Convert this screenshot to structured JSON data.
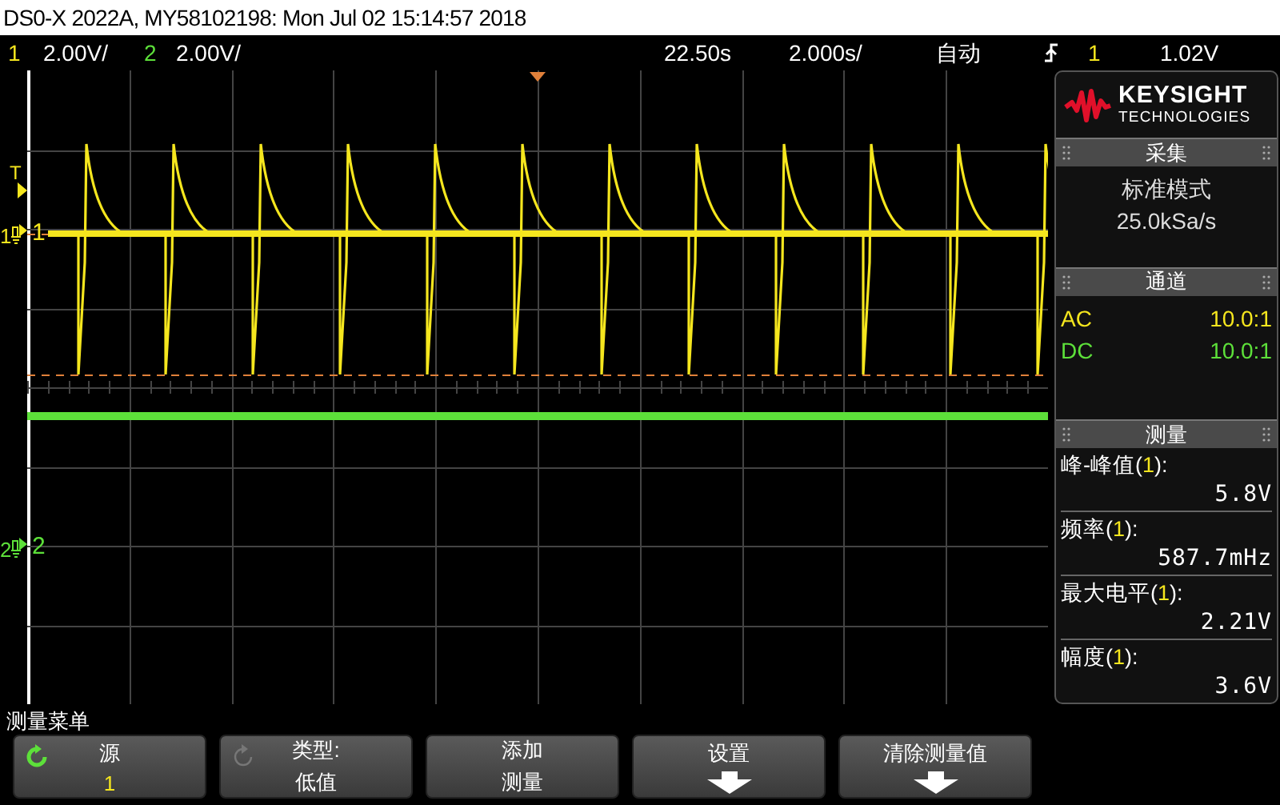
{
  "window": {
    "title": "DS0-X 2022A, MY58102198: Mon Jul 02 15:14:57 2018"
  },
  "status_bar": {
    "channels": [
      {
        "number": "1",
        "scale": "2.00V/",
        "color": "#f5e61e"
      },
      {
        "number": "2",
        "scale": "2.00V/",
        "color": "#5de03a"
      }
    ],
    "time_offset": "22.50s",
    "time_scale": "2.000s/",
    "trigger_mode": "自动",
    "trigger_source": "1",
    "trigger_level": "1.02V"
  },
  "screen": {
    "markers": [
      {
        "kind": "trigger",
        "label": "T",
        "color": "#f5e61e"
      },
      {
        "kind": "channel",
        "label": "1",
        "tag": "1",
        "color": "#f5e61e"
      },
      {
        "kind": "channel",
        "label": "2",
        "tag": "2",
        "color": "#5de03a"
      }
    ]
  },
  "panel": {
    "logo": {
      "name": "KEYSIGHT",
      "subtitle": "TECHNOLOGIES"
    },
    "acquisition": {
      "title": "采集",
      "mode": "标准模式",
      "rate": "25.0kSa/s"
    },
    "channels": {
      "title": "通道",
      "rows": [
        {
          "coupling": "AC",
          "probe": "10.0:1",
          "color": "#f5e61e"
        },
        {
          "coupling": "DC",
          "probe": "10.0:1",
          "color": "#5de03a"
        }
      ]
    },
    "measurements": {
      "title": "测量",
      "items": [
        {
          "prefix": "峰-峰值(",
          "source": "1",
          "suffix": "):",
          "value": "5.8V"
        },
        {
          "prefix": "频率(",
          "source": "1",
          "suffix": "):",
          "value": "587.7mHz"
        },
        {
          "prefix": "最大电平(",
          "source": "1",
          "suffix": "):",
          "value": "2.21V"
        },
        {
          "prefix": "幅度(",
          "source": "1",
          "suffix": "):",
          "value": "3.6V"
        }
      ]
    }
  },
  "menu": {
    "title": "测量菜单",
    "softkeys": [
      {
        "kind": "knob",
        "label": "源",
        "value": "1",
        "active": true,
        "color": "#f5e61e"
      },
      {
        "kind": "knob",
        "label": "类型:",
        "value": "低值",
        "active": false,
        "color": "#ffffff"
      },
      {
        "kind": "text",
        "label": "添加",
        "value": "测量"
      },
      {
        "kind": "submenu",
        "label": "设置"
      },
      {
        "kind": "submenu",
        "label": "清除测量值"
      }
    ]
  }
}
